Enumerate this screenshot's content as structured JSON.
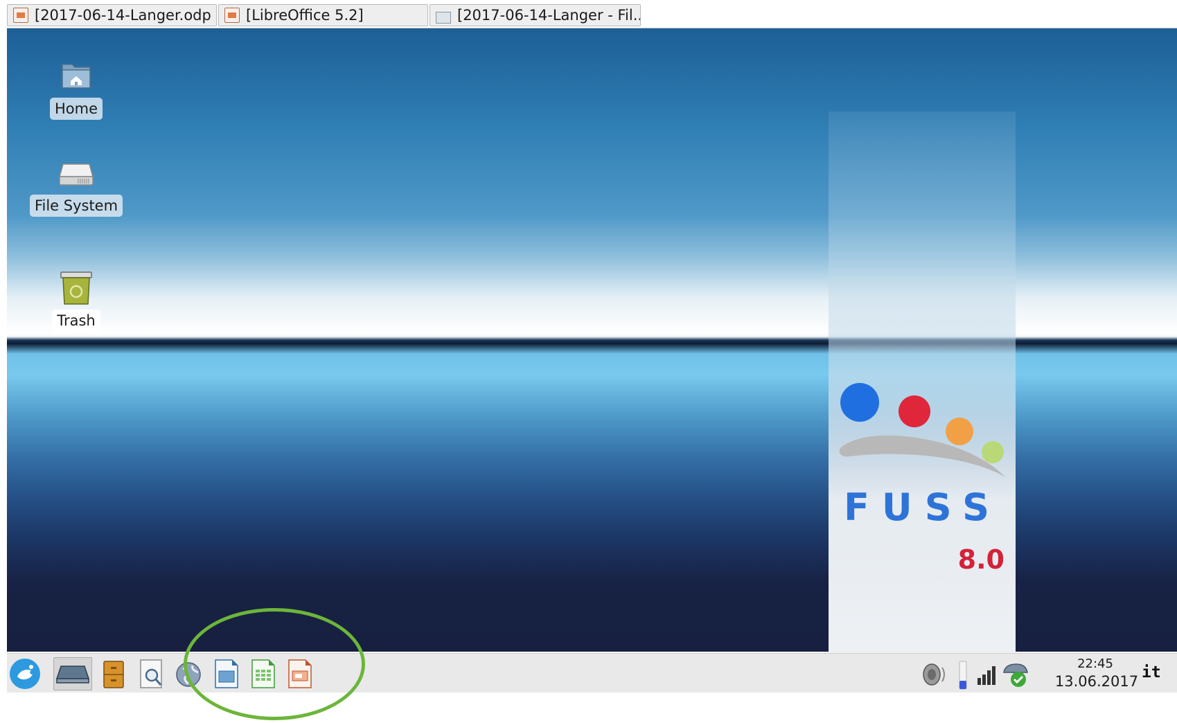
{
  "window_buttons": [
    {
      "title": "[2017-06-14-Langer.odp ...",
      "icon": "presentation-doc-icon"
    },
    {
      "title": "[LibreOffice 5.2]",
      "icon": "presentation-doc-icon"
    },
    {
      "title": "[2017-06-14-Langer - Fil...",
      "icon": "folder-icon"
    }
  ],
  "desktop_icons": [
    {
      "label": "Home",
      "icon": "home-folder-icon"
    },
    {
      "label": "File System",
      "icon": "drive-icon"
    },
    {
      "label": "Trash",
      "icon": "trash-icon"
    }
  ],
  "wallpaper": {
    "brand": "FUSS",
    "version": "8.0",
    "dot_colors": [
      "#1f6fe0",
      "#e0263a",
      "#f2a046",
      "#b9d978"
    ]
  },
  "taskbar": {
    "launchers": [
      {
        "name": "start-menu-icon"
      },
      {
        "name": "show-desktop-icon"
      },
      {
        "name": "file-manager-icon"
      },
      {
        "name": "document-viewer-icon"
      },
      {
        "name": "web-browser-icon"
      },
      {
        "name": "libreoffice-draw-icon"
      },
      {
        "name": "libreoffice-calc-icon"
      },
      {
        "name": "libreoffice-impress-icon"
      }
    ],
    "tray": [
      "volume-icon",
      "battery-icon",
      "network-signal-icon",
      "network-status-icon"
    ],
    "clock": {
      "time": "22:45",
      "date": "13.06.2017"
    },
    "keyboard_layout": "it"
  },
  "annotation": {
    "color": "#6db53a"
  }
}
